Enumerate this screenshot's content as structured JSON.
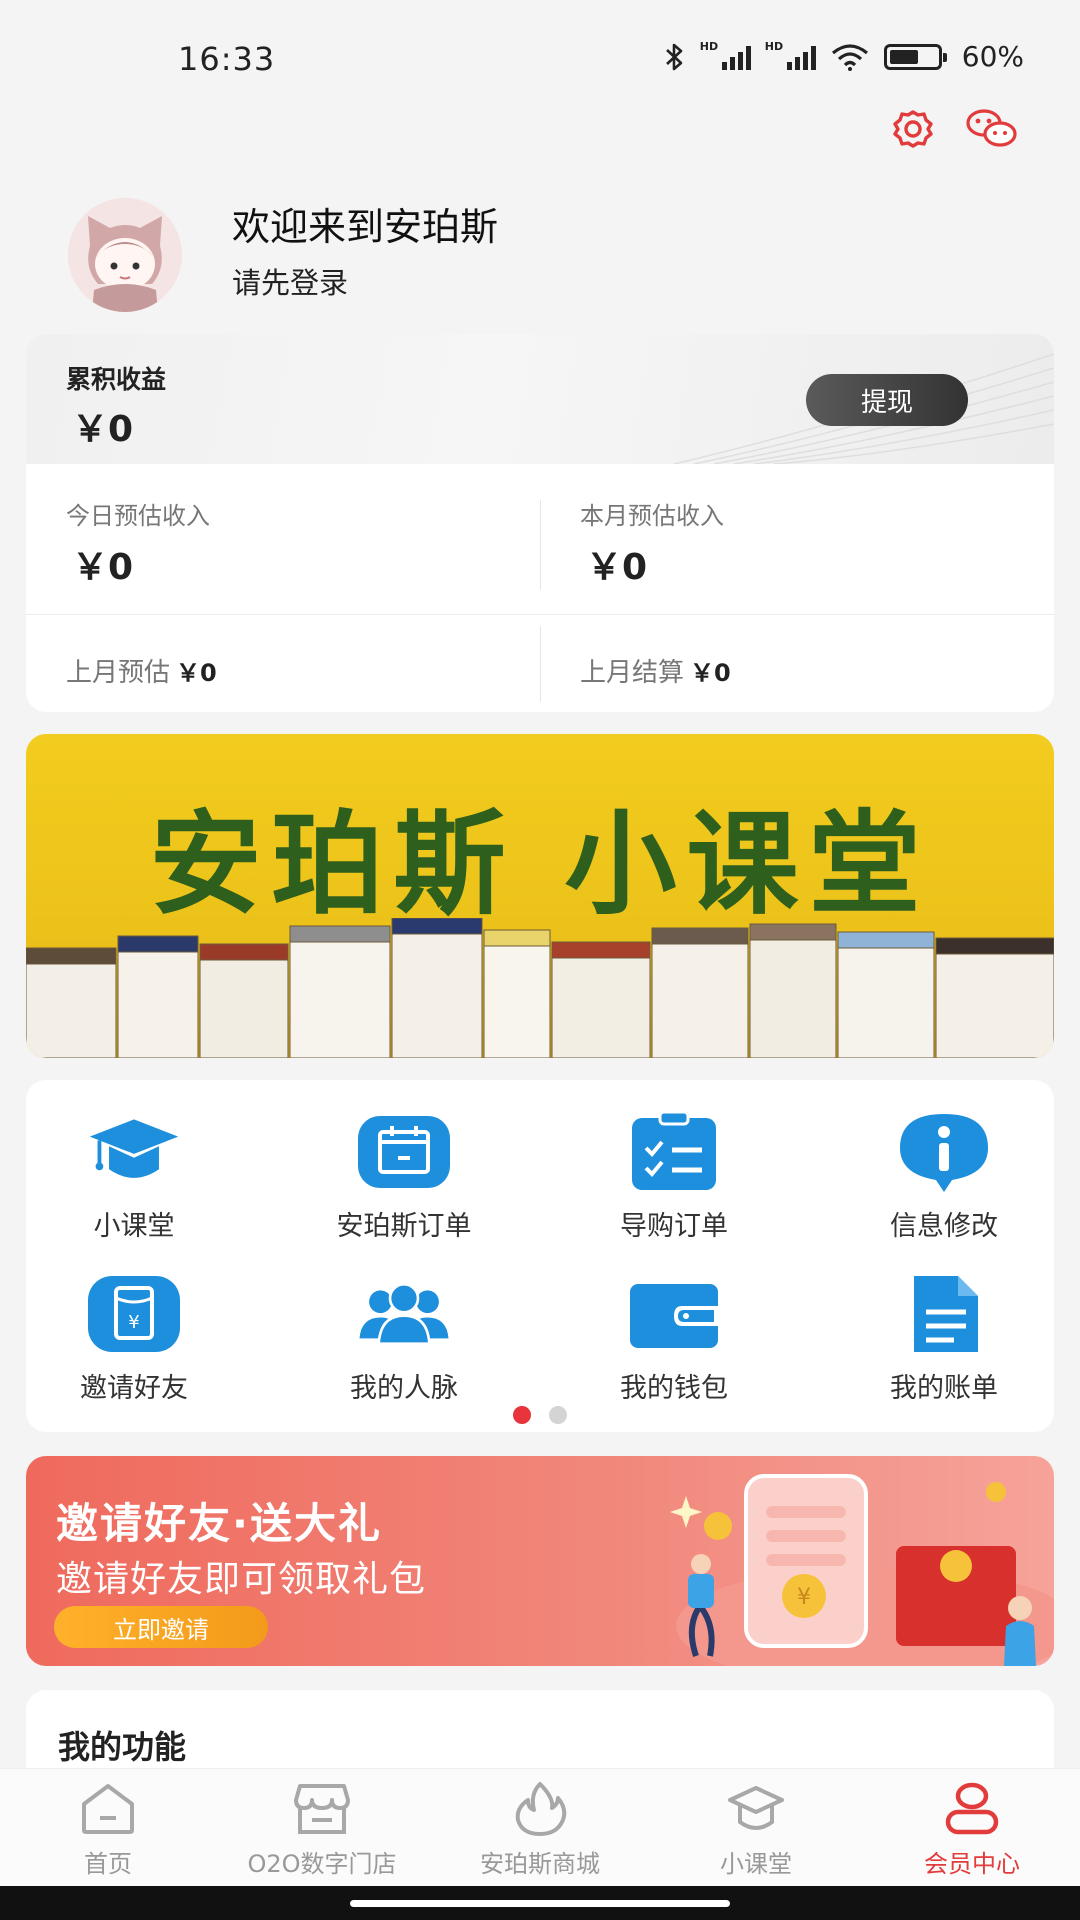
{
  "status_bar": {
    "time": "16:33",
    "battery_text": "60%",
    "hd_label": "HD"
  },
  "header": {
    "welcome": "欢迎来到安珀斯",
    "login_hint": "请先登录"
  },
  "earnings": {
    "cumulative_label": "累积收益",
    "cumulative_value": "￥0",
    "withdraw_label": "提现",
    "today_label": "今日预估收入",
    "today_value": "￥0",
    "month_label": "本月预估收入",
    "month_value": "￥0",
    "last_month_est_label": "上月预估",
    "last_month_est_value": "￥0",
    "last_month_settle_label": "上月结算",
    "last_month_settle_value": "￥0"
  },
  "class_banner": {
    "title": "安珀斯 小课堂"
  },
  "functions": [
    {
      "label": "小课堂",
      "icon": "graduation-cap-icon"
    },
    {
      "label": "安珀斯订单",
      "icon": "calendar-icon"
    },
    {
      "label": "导购订单",
      "icon": "clipboard-checklist-icon"
    },
    {
      "label": "信息修改",
      "icon": "info-icon"
    },
    {
      "label": "邀请好友",
      "icon": "red-envelope-icon"
    },
    {
      "label": "我的人脉",
      "icon": "people-icon"
    },
    {
      "label": "我的钱包",
      "icon": "wallet-icon"
    },
    {
      "label": "我的账单",
      "icon": "bill-icon"
    }
  ],
  "pager": {
    "pages": 2,
    "active": 0
  },
  "invite_banner": {
    "title": "邀请好友·送大礼",
    "subtitle": "邀请好友即可领取礼包",
    "button": "立即邀请"
  },
  "my_functions": {
    "title": "我的功能"
  },
  "bottom_nav": [
    {
      "label": "首页",
      "icon": "home-icon",
      "active": false
    },
    {
      "label": "O2O数字门店",
      "icon": "store-icon",
      "active": false
    },
    {
      "label": "安珀斯商城",
      "icon": "flame-icon",
      "active": false
    },
    {
      "label": "小课堂",
      "icon": "graduation-cap-icon",
      "active": false
    },
    {
      "label": "会员中心",
      "icon": "user-icon",
      "active": true
    }
  ],
  "colors": {
    "accent": "#e23b3b",
    "function_blue": "#1e8fdc",
    "banner_yellow": "#f2cc1e",
    "banner_green_text": "#2f5f1c",
    "invite_red": "#ef6a5d"
  }
}
